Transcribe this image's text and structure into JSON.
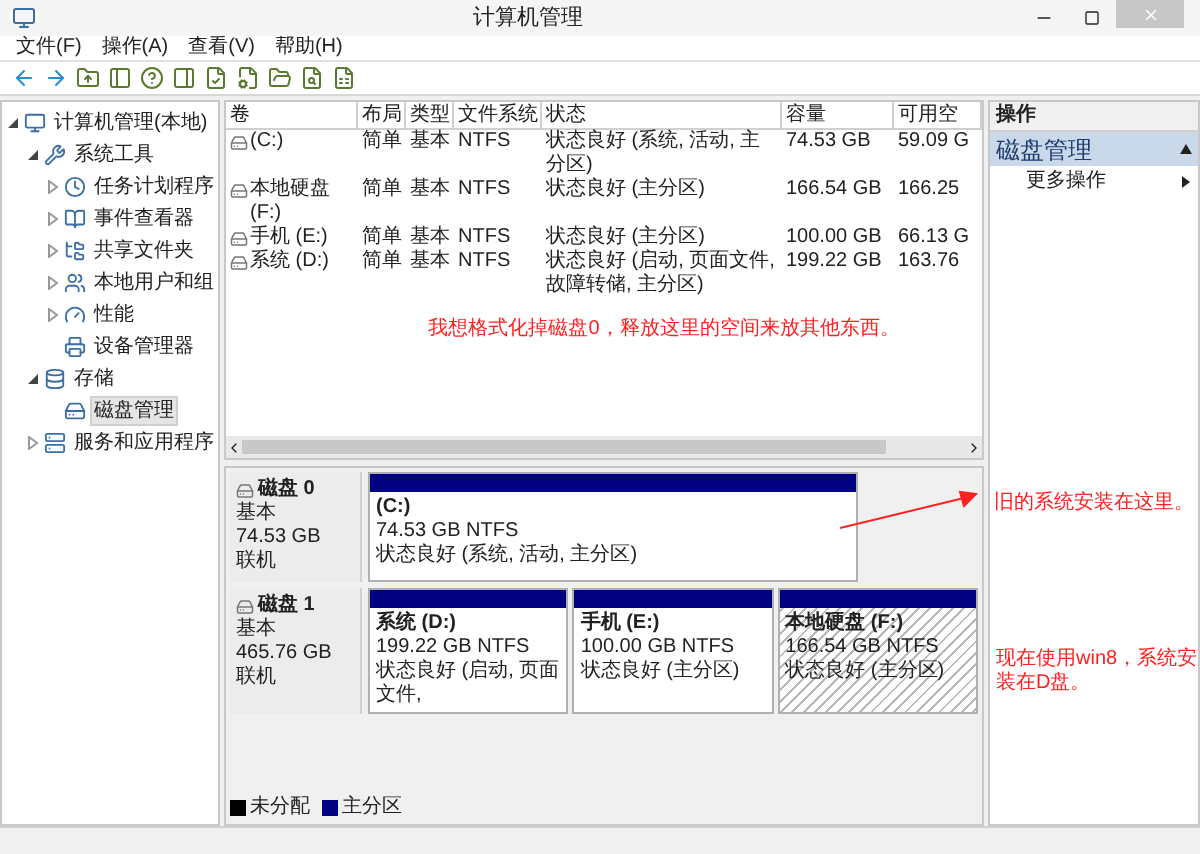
{
  "window": {
    "title": "计算机管理"
  },
  "menu": [
    "文件(F)",
    "操作(A)",
    "查看(V)",
    "帮助(H)"
  ],
  "tree": [
    {
      "label": "计算机管理(本地)",
      "expanded": true,
      "selected": false,
      "children": [
        {
          "label": "系统工具",
          "expanded": true,
          "selected": false,
          "children": [
            {
              "label": "任务计划程序",
              "expanded": false,
              "selected": false
            },
            {
              "label": "事件查看器",
              "expanded": false,
              "selected": false
            },
            {
              "label": "共享文件夹",
              "expanded": false,
              "selected": false
            },
            {
              "label": "本地用户和组",
              "expanded": false,
              "selected": false
            },
            {
              "label": "性能",
              "expanded": false,
              "selected": false
            },
            {
              "label": "设备管理器",
              "selected": false
            }
          ]
        },
        {
          "label": "存储",
          "expanded": true,
          "selected": false,
          "children": [
            {
              "label": "磁盘管理",
              "selected": true
            }
          ]
        },
        {
          "label": "服务和应用程序",
          "expanded": false,
          "selected": false
        }
      ]
    }
  ],
  "table": {
    "columns": [
      "卷",
      "布局",
      "类型",
      "文件系统",
      "状态",
      "容量",
      "可用空"
    ],
    "rows": [
      [
        "(C:)",
        "简单",
        "基本",
        "NTFS",
        "状态良好 (系统, 活动, 主分区)",
        "74.53 GB",
        "59.09 G"
      ],
      [
        "本地硬盘 (F:)",
        "简单",
        "基本",
        "NTFS",
        "状态良好 (主分区)",
        "166.54 GB",
        "166.25"
      ],
      [
        "手机 (E:)",
        "简单",
        "基本",
        "NTFS",
        "状态良好 (主分区)",
        "100.00 GB",
        "66.13 G"
      ],
      [
        "系统 (D:)",
        "简单",
        "基本",
        "NTFS",
        "状态良好 (启动, 页面文件, 故障转储, 主分区)",
        "199.22 GB",
        "163.76"
      ]
    ]
  },
  "note_top": "我想格式化掉磁盘0，释放这里的空间来放其他东西。",
  "disks": [
    {
      "name": "磁盘 0",
      "type": "基本",
      "size": "74.53 GB",
      "status": "联机",
      "partitions": [
        {
          "name": "(C:)",
          "size": "74.53 GB NTFS",
          "status": "状态良好 (系统, 活动, 主分区)",
          "selected": false
        }
      ]
    },
    {
      "name": "磁盘 1",
      "type": "基本",
      "size": "465.76 GB",
      "status": "联机",
      "partitions": [
        {
          "name": "系统 (D:)",
          "size": "199.22 GB NTFS",
          "status": "状态良好 (启动, 页面文件,",
          "selected": false
        },
        {
          "name": "手机 (E:)",
          "size": "100.00 GB NTFS",
          "status": "状态良好 (主分区)",
          "selected": false
        },
        {
          "name": "本地硬盘 (F:)",
          "size": "166.54 GB NTFS",
          "status": "状态良好 (主分区)",
          "selected": true
        }
      ]
    }
  ],
  "legend": [
    {
      "label": "未分配",
      "color": "#000000"
    },
    {
      "label": "主分区",
      "color": "#000080"
    }
  ],
  "actions": {
    "header": "操作",
    "section": "磁盘管理",
    "expanded": true,
    "items": [
      "更多操作"
    ]
  },
  "notes_side": [
    "旧的系统安装在这里。",
    "现在使用win8，系统安装在D盘。"
  ]
}
